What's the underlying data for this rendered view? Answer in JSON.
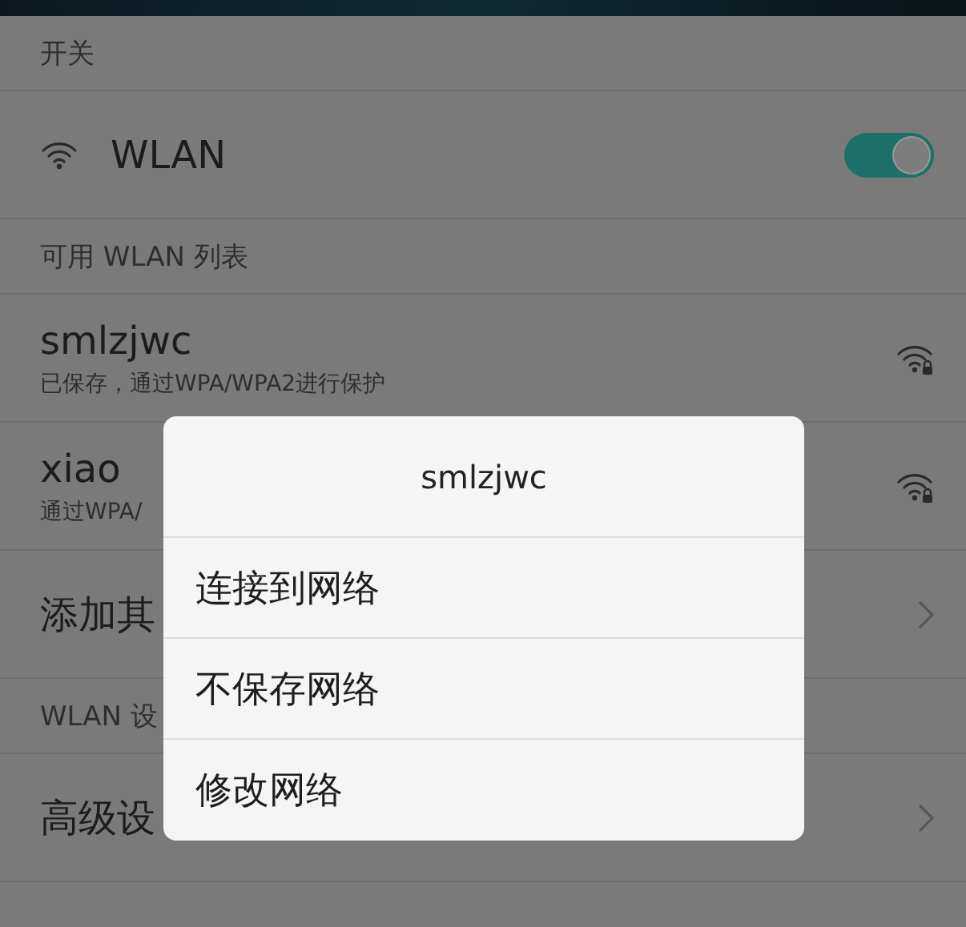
{
  "sections": [
    {
      "header": "开关",
      "items": [
        {
          "kind": "toggle",
          "label": "WLAN",
          "on": true
        }
      ]
    },
    {
      "header": "可用 WLAN 列表",
      "items": [
        {
          "kind": "network",
          "name": "smlzjwc",
          "detail": "已保存，通过WPA/WPA2进行保护"
        },
        {
          "kind": "network",
          "name": "xiao",
          "detail": "通过WPA/"
        },
        {
          "kind": "link",
          "label": "添加其"
        }
      ]
    },
    {
      "header": "WLAN 设",
      "items": [
        {
          "kind": "link",
          "label": "高级设"
        }
      ]
    }
  ],
  "dialog": {
    "title": "smlzjwc",
    "options": [
      "连接到网络",
      "不保存网络",
      "修改网络"
    ]
  }
}
